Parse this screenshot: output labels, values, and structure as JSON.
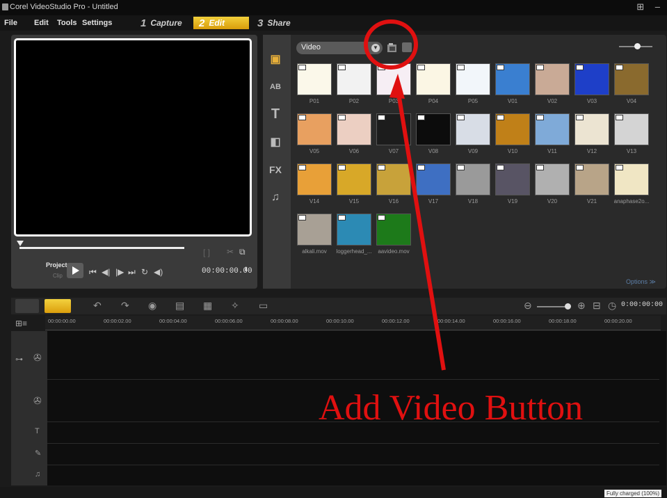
{
  "window": {
    "title": "Corel VideoStudio Pro - Untitled",
    "controls": "⊞ –"
  },
  "menu": {
    "items": [
      "File",
      "Edit",
      "Tools",
      "Settings"
    ]
  },
  "steps": [
    {
      "num": "1",
      "label": "Capture"
    },
    {
      "num": "2",
      "label": "Edit"
    },
    {
      "num": "3",
      "label": "Share"
    }
  ],
  "preview": {
    "mode_project": "Project",
    "mode_clip": "Clip",
    "timecode": "00:00:00.00",
    "trim_marks": "[ ]",
    "transport": [
      "⏮",
      "◀|",
      "|▶",
      "⏭",
      "↻",
      "◀)"
    ]
  },
  "library": {
    "category": "Video",
    "options_label": "Options",
    "side_icons": [
      "media-icon",
      "instant-project-icon",
      "title-icon",
      "graphic-icon",
      "fx-icon",
      "audio-icon"
    ],
    "side_glyphs": [
      "▣",
      "AB",
      "T",
      "◧",
      "FX",
      "♫"
    ],
    "items": [
      {
        "label": "P01",
        "color": "#fbf8ea"
      },
      {
        "label": "P02",
        "color": "#f2f2f2"
      },
      {
        "label": "P03",
        "color": "#f6eef4"
      },
      {
        "label": "P04",
        "color": "#fbf6e4"
      },
      {
        "label": "P05",
        "color": "#f2f6fa"
      },
      {
        "label": "V01",
        "color": "#3a7fd0"
      },
      {
        "label": "V02",
        "color": "#c9aa96"
      },
      {
        "label": "V03",
        "color": "#1e3fc8"
      },
      {
        "label": "V04",
        "color": "#8a6a2e"
      },
      {
        "label": "V05",
        "color": "#e8a060"
      },
      {
        "label": "V06",
        "color": "#eccfc2"
      },
      {
        "label": "V07",
        "color": "#1c1c1c"
      },
      {
        "label": "V08",
        "color": "#0c0c0c"
      },
      {
        "label": "V09",
        "color": "#d8dde6"
      },
      {
        "label": "V10",
        "color": "#c08018"
      },
      {
        "label": "V11",
        "color": "#7faad8"
      },
      {
        "label": "V12",
        "color": "#ece4d2"
      },
      {
        "label": "V13",
        "color": "#d4d4d4"
      },
      {
        "label": "V14",
        "color": "#e8a038"
      },
      {
        "label": "V15",
        "color": "#d8a828"
      },
      {
        "label": "V16",
        "color": "#c8a23a"
      },
      {
        "label": "V17",
        "color": "#3e6fc2"
      },
      {
        "label": "V18",
        "color": "#9a9a9a"
      },
      {
        "label": "V19",
        "color": "#585464"
      },
      {
        "label": "V20",
        "color": "#b0b0b0"
      },
      {
        "label": "V21",
        "color": "#b8a488"
      },
      {
        "label": "anaphase2o...",
        "color": "#f0e6c4"
      },
      {
        "label": "alkali.mov",
        "color": "#a8a095"
      },
      {
        "label": "loggerhead_...",
        "color": "#2c8ab4"
      },
      {
        "label": "aavideo.mov",
        "color": "#1d7a1a"
      }
    ]
  },
  "timeline": {
    "timecode": "0:00:00:00",
    "ruler_labels": [
      "00:00:00.00",
      "00:00:02.00",
      "00:00:04.00",
      "00:00:06.00",
      "00:00:08.00",
      "00:00:10.00",
      "00:00:12.00",
      "00:00:14.00",
      "00:00:16.00",
      "00:00:18.00",
      "00:00:20.00"
    ],
    "tracks": [
      "video-track",
      "overlay-track",
      "title-track",
      "voice-track",
      "music-track"
    ]
  },
  "status": {
    "text": "Fully charged (100%)"
  },
  "annotation": {
    "text": "Add Video Button",
    "color": "#e01010"
  }
}
